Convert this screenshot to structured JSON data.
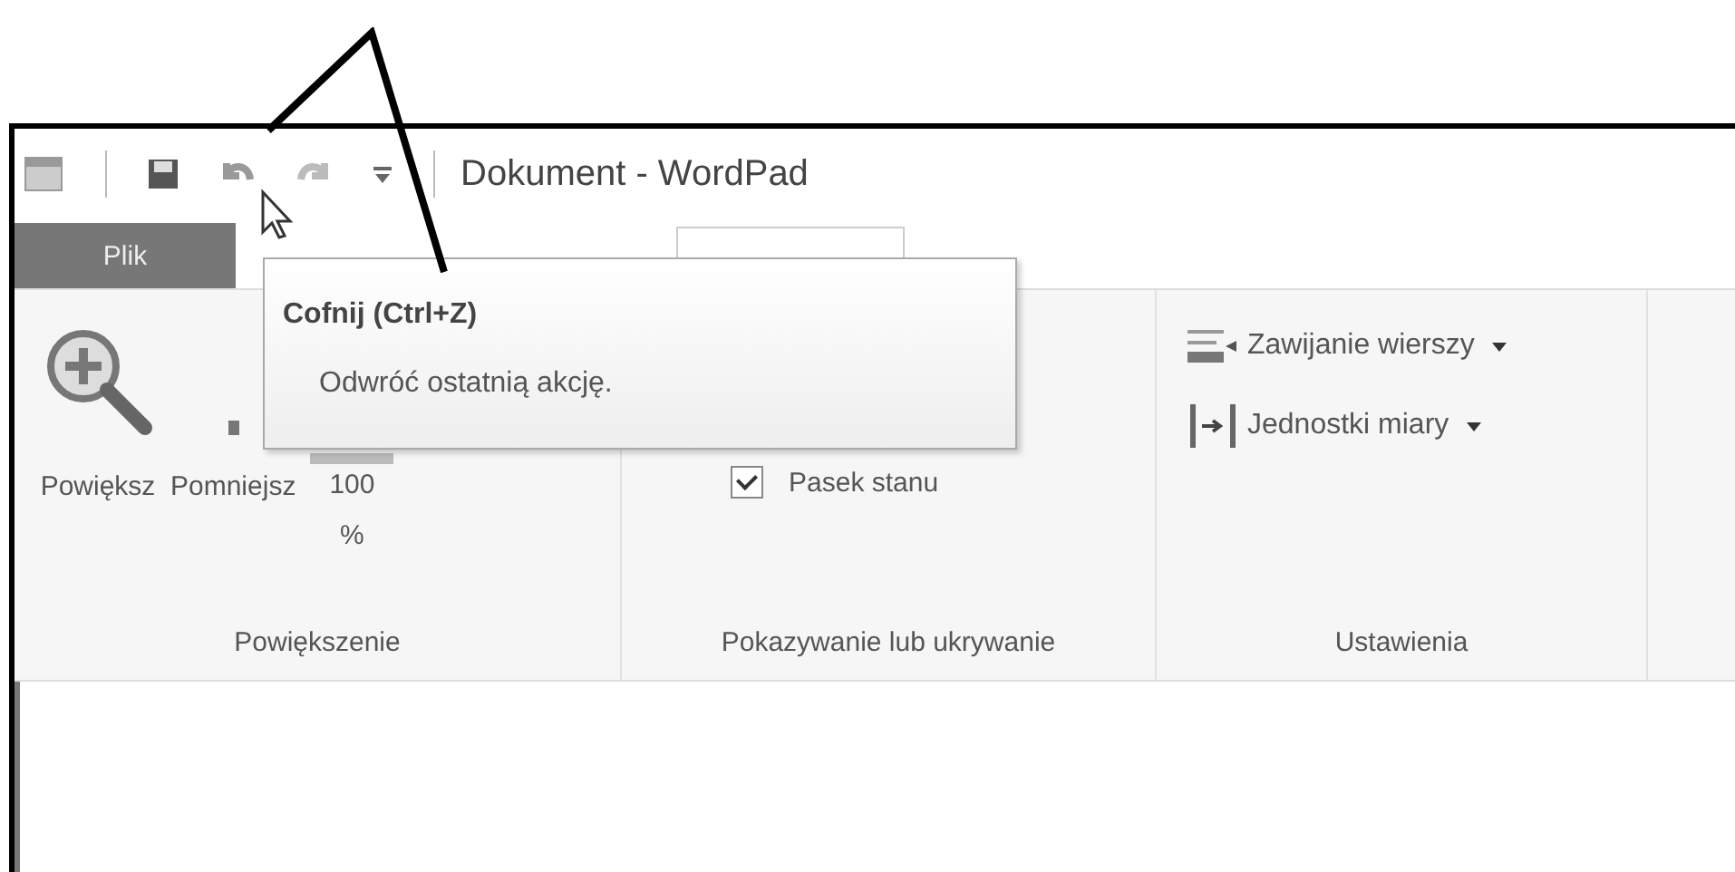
{
  "window": {
    "title": "Dokument - WordPad"
  },
  "file_tab": {
    "label": "Plik"
  },
  "ribbon": {
    "groups": [
      {
        "label": "Powiększenie",
        "items": [
          {
            "kind": "zoom-in",
            "label": "Powiększ"
          },
          {
            "kind": "zoom-out",
            "label": "Pomniejsz"
          },
          {
            "kind": "zoom-100",
            "label": "100 %"
          }
        ]
      },
      {
        "label": "Pokazywanie lub ukrywanie",
        "items": [
          {
            "kind": "checkbox",
            "label": "Pasek stanu",
            "checked": true
          }
        ]
      },
      {
        "label": "Ustawienia",
        "items": [
          {
            "kind": "word-wrap",
            "label": "Zawijanie wierszy"
          },
          {
            "kind": "units",
            "label": "Jednostki miary"
          }
        ]
      }
    ]
  },
  "tooltip": {
    "title": "Cofnij (Ctrl+Z)",
    "description": "Odwróć ostatnią akcję."
  }
}
